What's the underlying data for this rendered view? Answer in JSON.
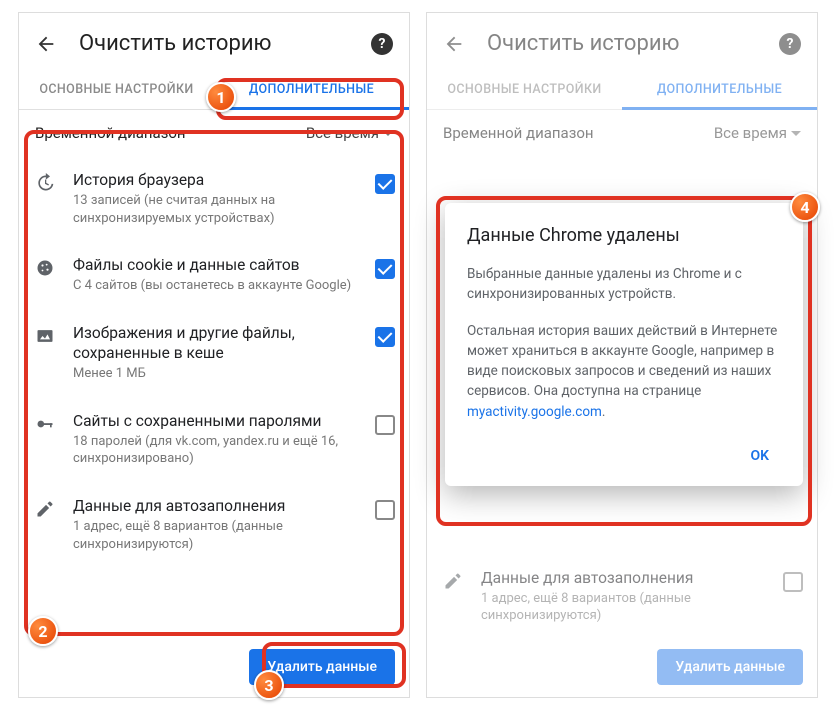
{
  "header": {
    "title": "Очистить историю"
  },
  "tabs": {
    "basic": "ОСНОВНЫЕ НАСТРОЙКИ",
    "advanced": "ДОПОЛНИТЕЛЬНЫЕ"
  },
  "range": {
    "label": "Временной диапазон",
    "value": "Все время"
  },
  "items": [
    {
      "title": "История браузера",
      "sub": "13 записей (не считая данных на синхронизируемых устройствах)",
      "checked": true
    },
    {
      "title": "Файлы cookie и данные сайтов",
      "sub": "С 4 сайтов (вы останетесь в аккаунте Google)",
      "checked": true
    },
    {
      "title": "Изображения и другие файлы, сохраненные в кеше",
      "sub": "Менее 1 МБ",
      "checked": true
    },
    {
      "title": "Сайты с сохраненными паролями",
      "sub": "18 паролей (для vk.com, yandex.ru и ещё 16, синхронизировано)",
      "checked": false
    },
    {
      "title": "Данные для автозаполнения",
      "sub": "1 адрес, ещё 8 вариантов (данные синхронизируются)",
      "checked": false
    }
  ],
  "right_visible_item": {
    "title": "Данные для автозаполнения",
    "sub": "1 адрес, ещё 8 вариантов (данные синхронизируются)"
  },
  "delete_btn": "Удалить данные",
  "dialog": {
    "title": "Данные Chrome удалены",
    "p1": "Выбранные данные удалены из Chrome и с синхронизированных устройств.",
    "p2_a": "Остальная история ваших действий в Интернете может храниться в аккаунте Google, например в виде поисковых запросов и сведений из наших сервисов. Она доступна на странице ",
    "p2_link": "myactivity.google.com",
    "p2_b": ".",
    "ok": "OK"
  },
  "badges": {
    "b1": "1",
    "b2": "2",
    "b3": "3",
    "b4": "4"
  }
}
